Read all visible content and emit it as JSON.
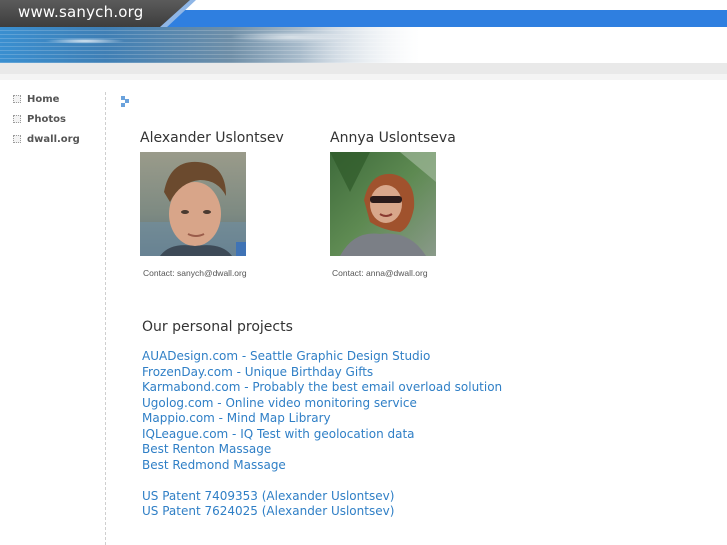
{
  "header": {
    "site_title": "www.sanych.org"
  },
  "sidebar": {
    "items": [
      {
        "label": "Home"
      },
      {
        "label": "Photos"
      },
      {
        "label": "dwall.org"
      }
    ]
  },
  "people": [
    {
      "name": "Alexander Uslontsev",
      "contact": "Contact: sanych@dwall.org"
    },
    {
      "name": "Annya Uslontseva",
      "contact": "Contact: anna@dwall.org"
    }
  ],
  "projects": {
    "title": "Our personal projects",
    "links": [
      "AUADesign.com - Seattle Graphic Design Studio",
      "FrozenDay.com - Unique Birthday Gifts",
      "Karmabond.com - Probably the best email overload solution",
      "Ugolog.com - Online video monitoring service",
      "Mappio.com - Mind Map Library",
      "IQLeague.com - IQ Test with geolocation data",
      "Best Renton Massage",
      "Best Redmond Massage"
    ],
    "patents": [
      "US Patent 7409353 (Alexander Uslontsev)",
      "US Patent 7624025 (Alexander Uslontsev)"
    ]
  },
  "colors": {
    "link": "#2f7fc6",
    "header_blue": "#2f7fe0",
    "header_dark": "#4a4a4a"
  }
}
